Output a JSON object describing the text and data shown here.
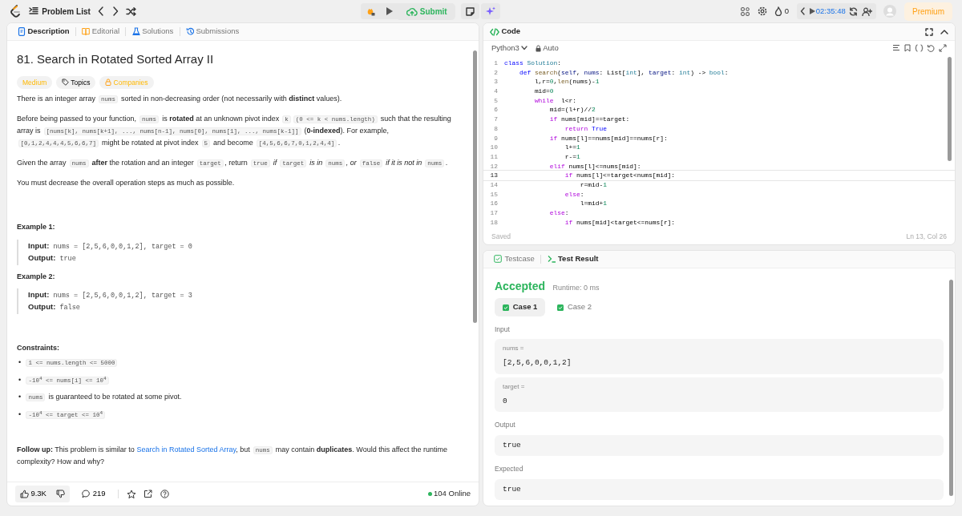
{
  "topbar": {
    "nav_label": "Problem List",
    "submit": "Submit",
    "streak": "0",
    "timer": "02:35:48",
    "premium": "Premium"
  },
  "description": {
    "tabs": [
      {
        "label": "Description",
        "selected": true
      },
      {
        "label": "Editorial",
        "selected": false
      },
      {
        "label": "Solutions",
        "selected": false
      },
      {
        "label": "Submissions",
        "selected": false
      }
    ],
    "title": "81. Search in Rotated Sorted Array II",
    "tags": [
      {
        "label": "Medium",
        "kind": "difficulty"
      },
      {
        "label": "Topics",
        "kind": "topics"
      },
      {
        "label": "Companies",
        "kind": "companies"
      }
    ],
    "paragraphs": [
      [
        {
          "kind": "text",
          "text": "There is an integer array "
        },
        {
          "kind": "code",
          "text": "nums"
        },
        {
          "kind": "text",
          "text": " sorted in non-decreasing order (not necessarily with "
        },
        {
          "kind": "bold",
          "text": "distinct"
        },
        {
          "kind": "text",
          "text": " values)."
        }
      ],
      [
        {
          "kind": "text",
          "text": "Before being passed to your function, "
        },
        {
          "kind": "code",
          "text": "nums"
        },
        {
          "kind": "text",
          "text": " is "
        },
        {
          "kind": "bold",
          "text": "rotated"
        },
        {
          "kind": "text",
          "text": " at an unknown pivot index "
        },
        {
          "kind": "code",
          "text": "k"
        },
        {
          "kind": "code",
          "text": "(0 <= k < nums.length)"
        },
        {
          "kind": "text",
          "text": " such that the resulting array is "
        },
        {
          "kind": "code",
          "text": "[nums[k], nums[k+1], ..., nums[n-1], nums[0], nums[1], ..., nums[k-1]]"
        },
        {
          "kind": "text",
          "text": " ("
        },
        {
          "kind": "bold",
          "text": "0-indexed"
        },
        {
          "kind": "text",
          "text": "). For example, "
        },
        {
          "kind": "code",
          "text": "[0,1,2,4,4,4,5,6,6,7]"
        },
        {
          "kind": "text",
          "text": " might be rotated at pivot index "
        },
        {
          "kind": "code",
          "text": "5"
        },
        {
          "kind": "text",
          "text": " and become "
        },
        {
          "kind": "code",
          "text": "[4,5,6,6,7,0,1,2,4,4]"
        },
        {
          "kind": "text",
          "text": "."
        }
      ],
      [
        {
          "kind": "text",
          "text": "Given the array "
        },
        {
          "kind": "code",
          "text": "nums"
        },
        {
          "kind": "bold",
          "text": " after"
        },
        {
          "kind": "text",
          "text": " the rotation and an integer "
        },
        {
          "kind": "code",
          "text": "target"
        },
        {
          "kind": "text",
          "text": ", return "
        },
        {
          "kind": "code",
          "text": "true"
        },
        {
          "kind": "italic",
          "text": " if "
        },
        {
          "kind": "code",
          "text": "target"
        },
        {
          "kind": "italic",
          "text": " is in "
        },
        {
          "kind": "code",
          "text": "nums"
        },
        {
          "kind": "italic",
          "text": ", or "
        },
        {
          "kind": "code",
          "text": "false"
        },
        {
          "kind": "italic",
          "text": " if it is not in "
        },
        {
          "kind": "code",
          "text": "nums"
        },
        {
          "kind": "text",
          "text": "."
        }
      ],
      [
        {
          "kind": "text",
          "text": "You must decrease the overall operation steps as much as possible."
        }
      ]
    ],
    "examples": [
      {
        "title": "Example 1:",
        "lines": [
          {
            "label": "Input:",
            "value": "nums = [2,5,6,0,0,1,2], target = 0"
          },
          {
            "label": "Output:",
            "value": "true"
          }
        ]
      },
      {
        "title": "Example 2:",
        "lines": [
          {
            "label": "Input:",
            "value": "nums = [2,5,6,0,0,1,2], target = 3"
          },
          {
            "label": "Output:",
            "value": "false"
          }
        ]
      }
    ],
    "constraints_title": "Constraints:",
    "constraints": [
      {
        "bullet": "•",
        "parts": [
          {
            "kind": "code",
            "text": "1 <= nums.length <= 5000"
          }
        ]
      },
      {
        "bullet": "•",
        "parts": [
          {
            "kind": "code",
            "text": "-10$^{4}$ <= nums[i] <= 10$^{4}$"
          }
        ]
      },
      {
        "bullet": "•",
        "parts": [
          {
            "kind": "code",
            "text": "nums"
          },
          {
            "kind": "text",
            "text": " is guaranteed to be rotated at some pivot."
          }
        ]
      },
      {
        "bullet": "•",
        "parts": [
          {
            "kind": "code",
            "text": "-10$^{4}$ <= target <= 10$^{4}$"
          }
        ]
      }
    ],
    "follow_up": [
      {
        "kind": "bold",
        "text": "Follow up:"
      },
      {
        "kind": "text",
        "text": " This problem is similar to "
      },
      {
        "kind": "link",
        "text": "Search in Rotated Sorted Array"
      },
      {
        "kind": "text",
        "text": ", but "
      },
      {
        "kind": "code",
        "text": "nums"
      },
      {
        "kind": "text",
        "text": " may contain "
      },
      {
        "kind": "bold",
        "text": "duplicates"
      },
      {
        "kind": "text",
        "text": ". Would this affect the runtime complexity? How and why?"
      }
    ],
    "footer": {
      "likes": "9.3K",
      "comments": "219",
      "online": "104 Online"
    }
  },
  "editor": {
    "title": "Code",
    "language": "Python3",
    "mode": "Auto",
    "status": "Saved",
    "position": "Ln 13, Col 26",
    "lines": [
      {
        "n": "1",
        "current": false,
        "tokens": [
          {
            "kind": "keyword",
            "text": "class "
          },
          {
            "kind": "type",
            "text": "Solution"
          },
          {
            "kind": "plain",
            "text": ":"
          }
        ]
      },
      {
        "n": "2",
        "current": false,
        "tokens": [
          {
            "kind": "keyword",
            "text": "    def "
          },
          {
            "kind": "function",
            "text": "search"
          },
          {
            "kind": "plain",
            "text": "("
          },
          {
            "kind": "variable",
            "text": "self"
          },
          {
            "kind": "plain",
            "text": ", "
          },
          {
            "kind": "variable",
            "text": "nums"
          },
          {
            "kind": "plain",
            "text": ": List["
          },
          {
            "kind": "type",
            "text": "int"
          },
          {
            "kind": "plain",
            "text": "], "
          },
          {
            "kind": "variable",
            "text": "target"
          },
          {
            "kind": "plain",
            "text": ": "
          },
          {
            "kind": "type",
            "text": "int"
          },
          {
            "kind": "plain",
            "text": ") -> "
          },
          {
            "kind": "type",
            "text": "bool"
          },
          {
            "kind": "plain",
            "text": ":"
          }
        ]
      },
      {
        "n": "3",
        "current": false,
        "tokens": [
          {
            "kind": "plain",
            "text": "        l,r="
          },
          {
            "kind": "number",
            "text": "0"
          },
          {
            "kind": "plain",
            "text": ","
          },
          {
            "kind": "function",
            "text": "len"
          },
          {
            "kind": "plain",
            "text": "(nums)-"
          },
          {
            "kind": "number",
            "text": "1"
          }
        ]
      },
      {
        "n": "4",
        "current": false,
        "tokens": [
          {
            "kind": "plain",
            "text": "        mid="
          },
          {
            "kind": "number",
            "text": "0"
          }
        ]
      },
      {
        "n": "5",
        "current": false,
        "tokens": [
          {
            "kind": "control",
            "text": "        while"
          },
          {
            "kind": "plain",
            "text": "  l<r:"
          }
        ]
      },
      {
        "n": "6",
        "current": false,
        "tokens": [
          {
            "kind": "plain",
            "text": "            mid=(l+r)//"
          },
          {
            "kind": "number",
            "text": "2"
          }
        ]
      },
      {
        "n": "7",
        "current": false,
        "tokens": [
          {
            "kind": "control",
            "text": "            if"
          },
          {
            "kind": "plain",
            "text": " nums[mid]==target:"
          }
        ]
      },
      {
        "n": "8",
        "current": false,
        "tokens": [
          {
            "kind": "control",
            "text": "                return "
          },
          {
            "kind": "keyword",
            "text": "True"
          }
        ]
      },
      {
        "n": "9",
        "current": false,
        "tokens": [
          {
            "kind": "control",
            "text": "            if"
          },
          {
            "kind": "plain",
            "text": " nums[l]==nums[mid]==nums[r]:"
          }
        ]
      },
      {
        "n": "10",
        "current": false,
        "tokens": [
          {
            "kind": "plain",
            "text": "                l+="
          },
          {
            "kind": "number",
            "text": "1"
          }
        ]
      },
      {
        "n": "11",
        "current": false,
        "tokens": [
          {
            "kind": "plain",
            "text": "                r-="
          },
          {
            "kind": "number",
            "text": "1"
          }
        ]
      },
      {
        "n": "12",
        "current": false,
        "tokens": [
          {
            "kind": "control",
            "text": "            elif"
          },
          {
            "kind": "plain",
            "text": " nums[l]<=nums[mid]:"
          }
        ]
      },
      {
        "n": "13",
        "current": true,
        "tokens": [
          {
            "kind": "control",
            "text": "                if"
          },
          {
            "kind": "plain",
            "text": " nums[l]<=target<nums[mid]:"
          }
        ]
      },
      {
        "n": "14",
        "current": false,
        "tokens": [
          {
            "kind": "plain",
            "text": "                    r=mid-"
          },
          {
            "kind": "number",
            "text": "1"
          }
        ]
      },
      {
        "n": "15",
        "current": false,
        "tokens": [
          {
            "kind": "control",
            "text": "                else"
          },
          {
            "kind": "plain",
            "text": ":"
          }
        ]
      },
      {
        "n": "16",
        "current": false,
        "tokens": [
          {
            "kind": "plain",
            "text": "                    l=mid+"
          },
          {
            "kind": "number",
            "text": "1"
          }
        ]
      },
      {
        "n": "17",
        "current": false,
        "tokens": [
          {
            "kind": "control",
            "text": "            else"
          },
          {
            "kind": "plain",
            "text": ":"
          }
        ]
      },
      {
        "n": "18",
        "current": false,
        "tokens": [
          {
            "kind": "control",
            "text": "                if"
          },
          {
            "kind": "plain",
            "text": " nums[mid]<target<=nums[r]:"
          }
        ]
      }
    ]
  },
  "results": {
    "tabs": [
      {
        "label": "Testcase",
        "selected": false
      },
      {
        "label": "Test Result",
        "selected": true
      }
    ],
    "verdict": "Accepted",
    "runtime": "Runtime: 0 ms",
    "cases": [
      {
        "label": "Case 1",
        "selected": true,
        "passed": true
      },
      {
        "label": "Case 2",
        "selected": false,
        "passed": true
      }
    ],
    "input_label": "Input",
    "inputs": [
      {
        "name": "nums =",
        "value": "[2,5,6,0,0,1,2]"
      },
      {
        "name": "target =",
        "value": "0"
      }
    ],
    "output_label": "Output",
    "output": "true",
    "expected_label": "Expected",
    "expected": "true"
  }
}
